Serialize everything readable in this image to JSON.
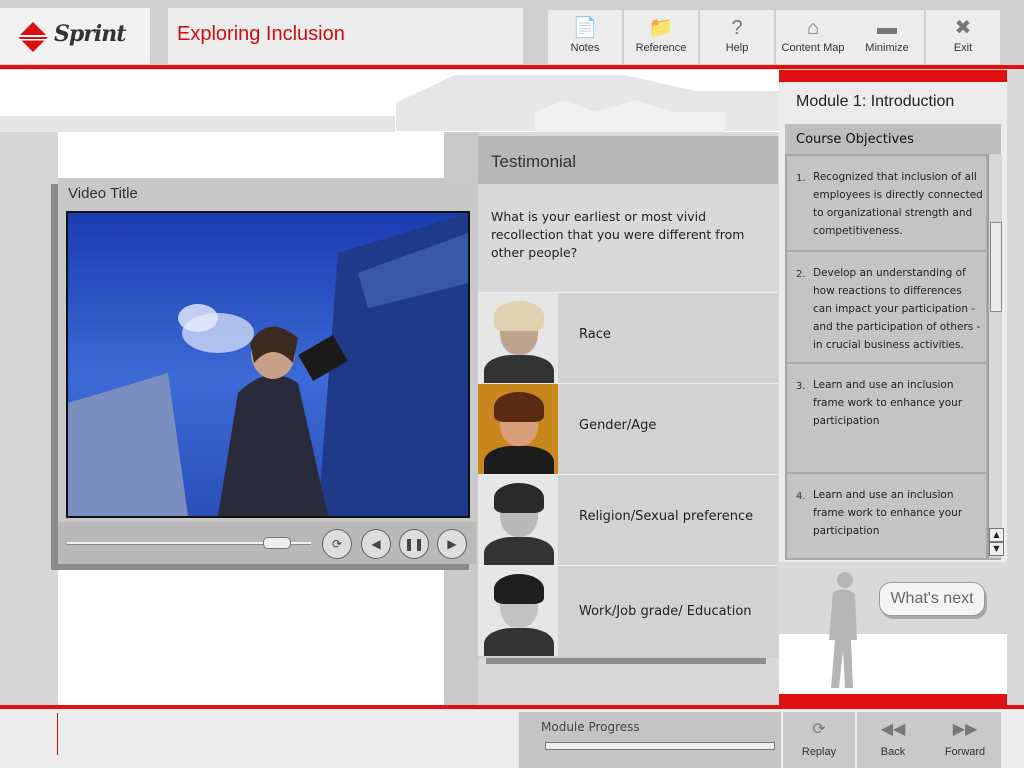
{
  "header": {
    "brand": "Sprint",
    "title": "Exploring Inclusion",
    "buttons": [
      {
        "label": "Notes",
        "icon": "notes-icon"
      },
      {
        "label": "Reference",
        "icon": "folder-icon"
      },
      {
        "label": "Help",
        "icon": "help-icon"
      },
      {
        "label": "Content Map",
        "icon": "house-icon"
      },
      {
        "label": "Minimize",
        "icon": "minimize-icon"
      },
      {
        "label": "Exit",
        "icon": "close-icon"
      }
    ]
  },
  "video": {
    "title": "Video Title"
  },
  "testimonial": {
    "title": "Testimonial",
    "question": "What is your earliest or most vivid recollection that you were different from other people?",
    "topics": [
      "Race",
      "Gender/Age",
      "Religion/Sexual preference",
      "Work/Job grade/ Education"
    ]
  },
  "module": {
    "title": "Module 1: Introduction",
    "objectives_title": "Course Objectives",
    "objectives": [
      {
        "num": "1.",
        "text": "Recognized that inclusion of all employees is directly connected to organizational strength and competitiveness."
      },
      {
        "num": "2.",
        "text": "Develop an understanding of how reactions to differences can impact your participation - and the participation of others - in crucial business activities."
      },
      {
        "num": "3.",
        "text": "Learn and use an inclusion frame work to enhance your participation"
      },
      {
        "num": "4.",
        "text": "Learn and use an inclusion frame work to enhance your participation"
      }
    ],
    "next_label": "What's next"
  },
  "footer": {
    "progress_label": "Module Progress",
    "replay": "Replay",
    "back": "Back",
    "forward": "Forward"
  },
  "colors": {
    "accent": "#e01010"
  }
}
